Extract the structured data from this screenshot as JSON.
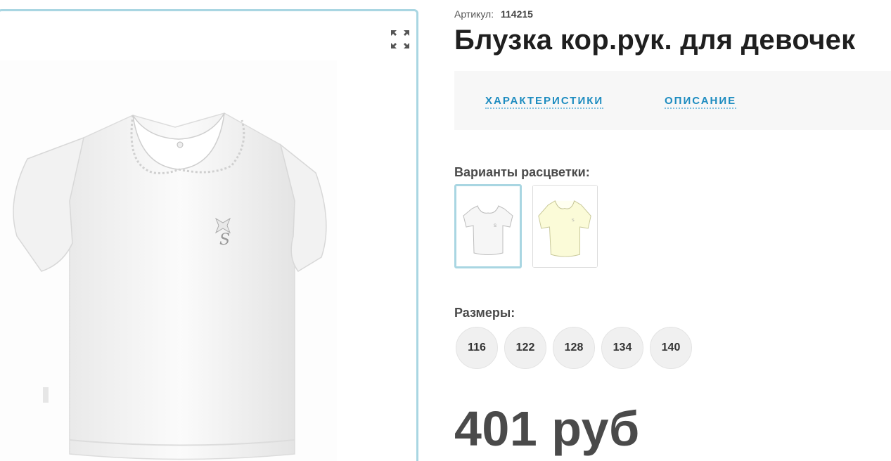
{
  "gallery": {
    "expand_icon": "expand-arrows-icon",
    "main_image": "white-short-sleeve-blouse-image"
  },
  "product": {
    "sku_label": "Артикул:",
    "sku_value": "114215",
    "title": "Блузка кор.рук. для девочек",
    "price": "401 руб"
  },
  "tabs": [
    {
      "label": "ХАРАКТЕРИСТИКИ"
    },
    {
      "label": "ОПИСАНИЕ"
    }
  ],
  "variants": {
    "label": "Варианты расцветки:",
    "items": [
      {
        "color": "#ffffff",
        "selected": true
      },
      {
        "color": "#fbfbd8",
        "selected": false
      }
    ]
  },
  "sizes": {
    "label": "Размеры:",
    "items": [
      "116",
      "122",
      "128",
      "134",
      "140"
    ]
  },
  "colors": {
    "accent": "#1d8cc0",
    "frame_border": "#a9d6e2",
    "price_text": "#4a4a4a"
  }
}
